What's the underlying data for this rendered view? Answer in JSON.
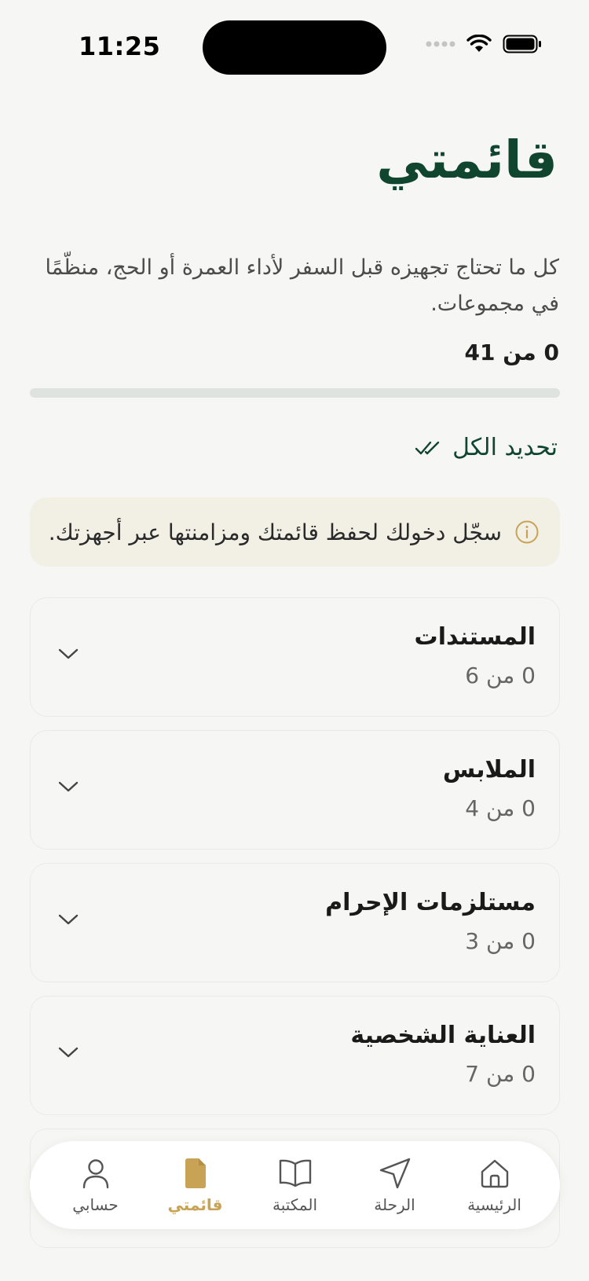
{
  "status": {
    "time": "11:25"
  },
  "header": {
    "title": "قائمتي"
  },
  "intro": {
    "text": "كل ما تحتاج تجهيزه قبل السفر لأداء العمرة أو الحج، منظّمًا في مجموعات."
  },
  "progress": {
    "label": "0 من 41",
    "done": 0,
    "total": 41
  },
  "actions": {
    "select_all": "تحديد الكل"
  },
  "banner": {
    "text": "سجّل دخولك لحفظ قائمتك ومزامنتها عبر أجهزتك."
  },
  "groups": [
    {
      "title": "المستندات",
      "count": "0 من 6"
    },
    {
      "title": "الملابس",
      "count": "0 من 4"
    },
    {
      "title": "مستلزمات الإحرام",
      "count": "0 من 3"
    },
    {
      "title": "العناية الشخصية",
      "count": "0 من 7"
    }
  ],
  "tabs": [
    {
      "label": "الرئيسية",
      "icon": "home-icon"
    },
    {
      "label": "الرحلة",
      "icon": "navigation-icon"
    },
    {
      "label": "المكتبة",
      "icon": "book-icon"
    },
    {
      "label": "قائمتي",
      "icon": "document-icon",
      "active": true
    },
    {
      "label": "حسابي",
      "icon": "user-icon"
    }
  ],
  "colors": {
    "primary": "#10452f",
    "accent": "#c9a355",
    "background": "#f6f6f4",
    "banner": "#f2efe5"
  }
}
